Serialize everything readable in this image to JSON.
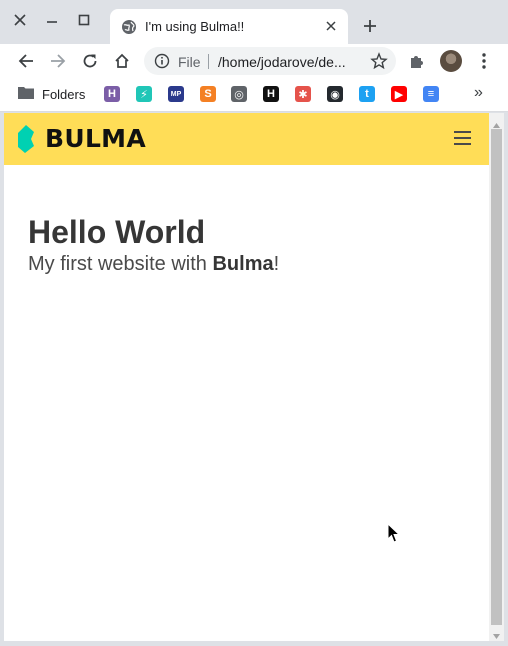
{
  "window": {
    "tab": {
      "title": "I'm using Bulma!!"
    },
    "address": {
      "scheme_label": "File",
      "url": "/home/jodarove/de..."
    },
    "bookmarks": {
      "folder_label": "Folders",
      "items": [
        {
          "name": "heroku",
          "glyph": "H",
          "color": "#7b5ea7"
        },
        {
          "name": "netlify",
          "glyph": "⚡",
          "color": "#20c6b7"
        },
        {
          "name": "mp",
          "glyph": "MP",
          "color": "#2b3a8c"
        },
        {
          "name": "stackoverflow",
          "glyph": "S",
          "color": "#f48024"
        },
        {
          "name": "digitalocean",
          "glyph": "◎",
          "color": "#5f6368"
        },
        {
          "name": "hackerrank",
          "glyph": "H",
          "color": "#111111"
        },
        {
          "name": "lifebuoy",
          "glyph": "✱",
          "color": "#e5534b"
        },
        {
          "name": "github",
          "glyph": "◉",
          "color": "#24292e"
        },
        {
          "name": "twitter",
          "glyph": "t",
          "color": "#1da1f2"
        },
        {
          "name": "youtube",
          "glyph": "▶",
          "color": "#ff0000"
        },
        {
          "name": "google-docs",
          "glyph": "≡",
          "color": "#4285f4"
        }
      ],
      "more_label": "»"
    }
  },
  "page": {
    "navbar": {
      "brand": "BULMA",
      "brand_color": "#00d1b2",
      "background": "#ffdd57"
    },
    "hero": {
      "title": "Hello World",
      "subtitle_prefix": "My first website with ",
      "subtitle_strong": "Bulma",
      "subtitle_suffix": "!"
    }
  }
}
